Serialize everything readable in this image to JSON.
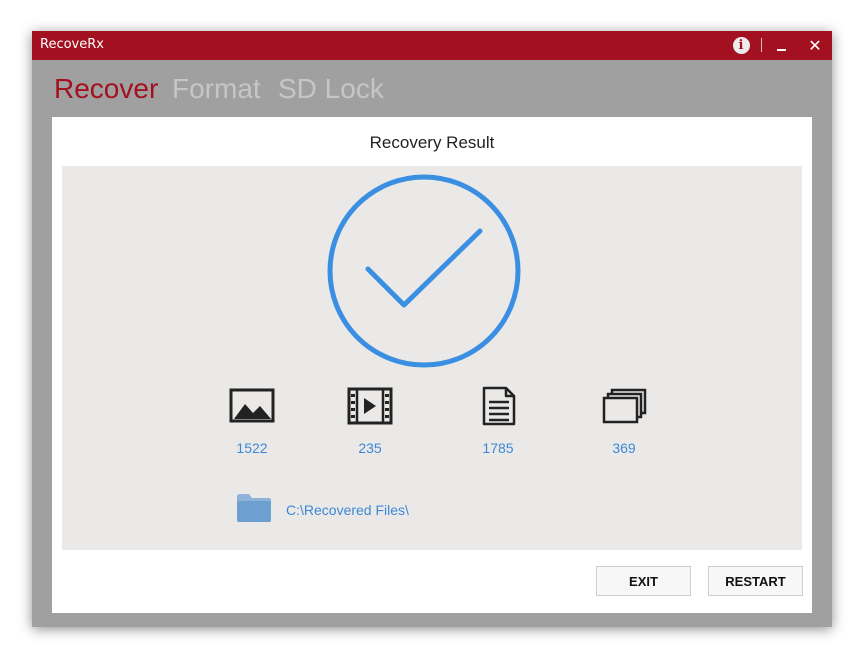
{
  "window": {
    "title": "RecoveRx"
  },
  "titlebar": {
    "info_label": "i",
    "close_label": "✕"
  },
  "nav": {
    "tabs": [
      {
        "label": "Recover",
        "active": true
      },
      {
        "label": "Format",
        "active": false
      },
      {
        "label": "SD Lock",
        "active": false
      }
    ]
  },
  "result": {
    "title": "Recovery Result",
    "stats": [
      {
        "icon": "image-icon",
        "count": "1522"
      },
      {
        "icon": "video-icon",
        "count": "235"
      },
      {
        "icon": "document-icon",
        "count": "1785"
      },
      {
        "icon": "other-files-icon",
        "count": "369"
      }
    ],
    "path": "C:\\Recovered Files\\"
  },
  "buttons": {
    "exit": "EXIT",
    "restart": "RESTART"
  },
  "colors": {
    "brand_red": "#a3101f",
    "accent_blue": "#3c88d6",
    "check_blue": "#3a8fe2",
    "content_bg": "#ebe9e7",
    "outer_gray": "#a0a0a0"
  }
}
